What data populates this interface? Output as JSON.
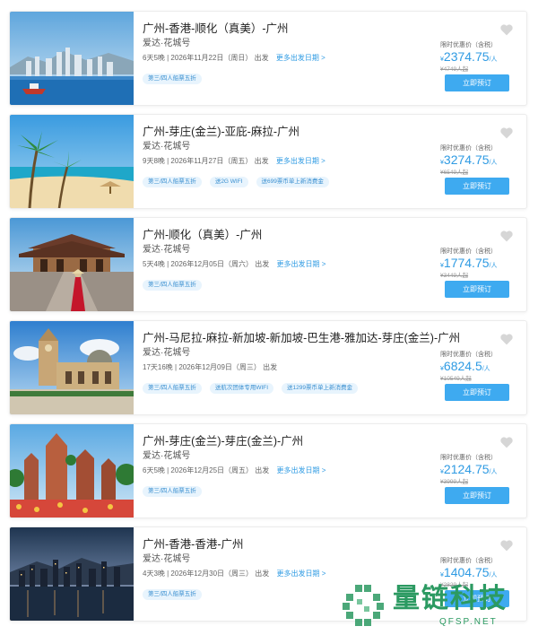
{
  "price_label": "限时优惠价（含税）",
  "currency": "¥",
  "unit": "/人",
  "book_label": "立即预订",
  "more_label": "更多出发日期 >",
  "depart_word": "出发",
  "cruises": [
    {
      "title": "广州-香港-顺化（真美）-广州",
      "ship": "爱达·花城号",
      "schedule": "6天5晚 | 2026年11月22日（周日）",
      "show_more": true,
      "tags": [
        "第三/四人船票五折"
      ],
      "price": "2374.75",
      "orig": "¥4749人起"
    },
    {
      "title": "广州-芽庄(金兰)-亚庇-麻拉-广州",
      "ship": "爱达·花城号",
      "schedule": "9天8晚 | 2026年11月27日（周五）",
      "show_more": true,
      "tags": [
        "第三/四人船票五折",
        "送2G WIFI",
        "送699票币单上新消费金"
      ],
      "price": "3274.75",
      "orig": "¥6549人起"
    },
    {
      "title": "广州-顺化（真美）-广州",
      "ship": "爱达·花城号",
      "schedule": "5天4晚 | 2026年12月05日（周六）",
      "show_more": true,
      "tags": [
        "第三/四人船票五折"
      ],
      "price": "1774.75",
      "orig": "¥3449人起"
    },
    {
      "title": "广州-马尼拉-麻拉-新加坡-新加坡-巴生港-雅加达-芽庄(金兰)-广州",
      "ship": "爱达·花城号",
      "schedule": "17天16晚 | 2026年12月09日（周三）",
      "show_more": false,
      "tags": [
        "第三/四人船票五折",
        "送航次团体专用WIFI",
        "送1299票币单上新消费金"
      ],
      "price": "6824.5",
      "orig": "¥10549人起"
    },
    {
      "title": "广州-芽庄(金兰)-芽庄(金兰)-广州",
      "ship": "爱达·花城号",
      "schedule": "6天5晚 | 2026年12月25日（周五）",
      "show_more": true,
      "tags": [
        "第三/四人船票五折"
      ],
      "price": "2124.75",
      "orig": "¥3999人起"
    },
    {
      "title": "广州-香港-香港-广州",
      "ship": "爱达·花城号",
      "schedule": "4天3晚 | 2026年12月30日（周三）",
      "show_more": true,
      "tags": [
        "第三/四人船票五折"
      ],
      "price": "1404.75",
      "orig": "¥2829人起"
    }
  ],
  "watermark": {
    "text": "量链科技",
    "domain": "QFSP.NET"
  },
  "colors": {
    "accent": "#3eaaf0",
    "price": "#2f9be3",
    "tag_bg": "#e8f4fd",
    "watermark": "#2c9a62"
  }
}
